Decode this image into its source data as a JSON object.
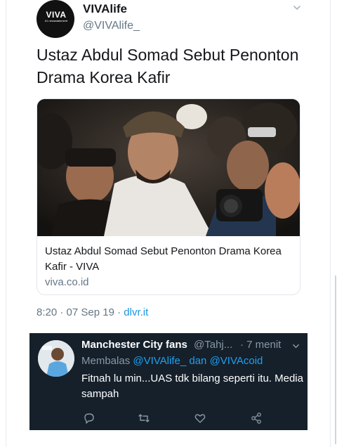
{
  "tweet": {
    "author_name": "VIVAlife",
    "author_handle": "@VIVAlife_",
    "avatar_logo": "VIVA",
    "avatar_tagline": "#1 newsstainment",
    "text": "Ustaz Abdul Somad Sebut Penonton Drama Korea Kafir",
    "card": {
      "title": "Ustaz Abdul Somad Sebut Penonton Drama Korea Kafir - VIVA",
      "domain": "viva.co.id"
    },
    "time": "8:20",
    "date": "07 Sep 19",
    "separator": "·",
    "source": "dlvr.it"
  },
  "reply": {
    "author_name": "Manchester City fans",
    "author_handle": "@Tahj...",
    "time": "· 7 menit",
    "replying_prefix": "Membalas",
    "mention_1": "@VIVAlife_",
    "joiner": "dan",
    "mention_2": "@VIVAcoid",
    "text": "Fitnah lu min...UAS tdk bilang seperti itu. Media sampah"
  },
  "icons": {
    "menu": "chevron-down-icon",
    "reply": "reply-icon",
    "retweet": "retweet-icon",
    "like": "heart-icon",
    "share": "share-icon"
  },
  "colors": {
    "link": "#1b95e0",
    "muted": "#657786",
    "dark_bg": "#15202b",
    "mention": "#1da1f2"
  }
}
